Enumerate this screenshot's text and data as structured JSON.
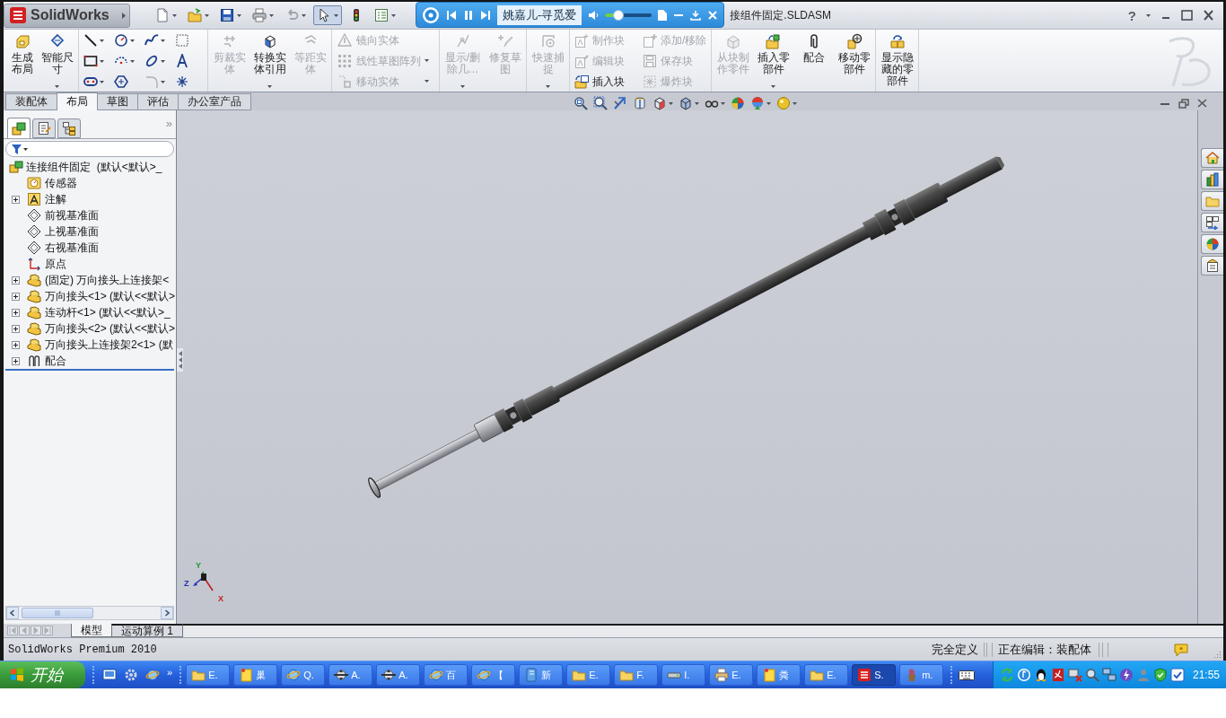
{
  "title_bar": {
    "logo": "SolidWorks",
    "document_title": "接组件固定.SLDASM",
    "help": "?"
  },
  "quick_access": [
    {
      "kind": "new",
      "dropdown": true,
      "pressed": false
    },
    {
      "kind": "open",
      "dropdown": true,
      "pressed": false
    },
    {
      "kind": "save",
      "dropdown": true,
      "pressed": false
    },
    {
      "kind": "print",
      "dropdown": true,
      "pressed": false
    },
    {
      "kind": "undo",
      "dropdown": true,
      "pressed": false
    },
    {
      "kind": "select",
      "dropdown": true,
      "pressed": true
    },
    {
      "kind": "rebuild",
      "dropdown": false,
      "pressed": false
    },
    {
      "kind": "options",
      "dropdown": true,
      "pressed": false
    }
  ],
  "media_player": {
    "track": "姚嘉儿-寻觅爱",
    "playing": true,
    "volume": {
      "level": 0.28
    }
  },
  "ribbon": {
    "sections": [
      {
        "kind": "large",
        "items": [
          {
            "kind": "layout",
            "label": "生成布局",
            "disabled": false,
            "dropdown": false
          },
          {
            "kind": "dimension",
            "label": "智能尺寸",
            "disabled": false,
            "dropdown": true
          }
        ]
      },
      {
        "kind": "grid",
        "items": [
          {
            "kind": "line",
            "disabled": false,
            "dropdown": true
          },
          {
            "kind": "circle",
            "disabled": false,
            "dropdown": true
          },
          {
            "kind": "spline",
            "disabled": false,
            "dropdown": true
          },
          {
            "kind": "grid",
            "disabled": false,
            "dropdown": false
          },
          {
            "kind": "rectangle",
            "disabled": false,
            "dropdown": true
          },
          {
            "kind": "arc",
            "disabled": false,
            "dropdown": true
          },
          {
            "kind": "ellipse",
            "disabled": false,
            "dropdown": true
          },
          {
            "kind": "text",
            "disabled": false,
            "dropdown": false
          },
          {
            "kind": "slot",
            "disabled": false,
            "dropdown": true
          },
          {
            "kind": "polygon",
            "disabled": false,
            "dropdown": false
          },
          {
            "kind": "fillet",
            "disabled": true,
            "dropdown": true
          },
          {
            "kind": "point",
            "disabled": false,
            "dropdown": false
          }
        ]
      },
      {
        "kind": "large",
        "items": [
          {
            "kind": "trim",
            "label": "剪裁实体",
            "disabled": true,
            "dropdown": false
          },
          {
            "kind": "convert",
            "label": "转换实体引用",
            "disabled": false,
            "dropdown": true
          },
          {
            "kind": "offset",
            "label": "等距实体",
            "disabled": true,
            "dropdown": false
          }
        ]
      },
      {
        "kind": "stack",
        "items": [
          {
            "kind": "mirror",
            "label": "镜向实体",
            "disabled": true,
            "dropdown": false
          },
          {
            "kind": "pattern",
            "label": "线性草图阵列",
            "disabled": true,
            "dropdown": true
          },
          {
            "kind": "move",
            "label": "移动实体",
            "disabled": true,
            "dropdown": true
          }
        ]
      },
      {
        "kind": "large",
        "items": [
          {
            "kind": "relations",
            "label": "显示/删除几…",
            "disabled": true,
            "dropdown": true
          },
          {
            "kind": "repair",
            "label": "修复草图",
            "disabled": true,
            "dropdown": false
          }
        ]
      },
      {
        "kind": "large",
        "items": [
          {
            "kind": "snap",
            "label": "快速捕捉",
            "disabled": true,
            "dropdown": true
          }
        ]
      },
      {
        "kind": "stack",
        "items": [
          {
            "kind": "makeblock",
            "label": "制作块",
            "disabled": true,
            "dropdown": false
          },
          {
            "kind": "editblock",
            "label": "编辑块",
            "disabled": true,
            "dropdown": false
          },
          {
            "kind": "insertblock",
            "label": "插入块",
            "disabled": false,
            "dropdown": false
          },
          {
            "kind": "addremove",
            "label": "添加/移除",
            "disabled": true,
            "dropdown": false
          },
          {
            "kind": "saveblock",
            "label": "保存块",
            "disabled": true,
            "dropdown": false
          },
          {
            "kind": "explodeblock",
            "label": "爆炸块",
            "disabled": true,
            "dropdown": false
          }
        ]
      },
      {
        "kind": "large",
        "items": [
          {
            "kind": "partfromblock",
            "label": "从块制作零件",
            "disabled": true,
            "dropdown": false
          },
          {
            "kind": "insertcomponent",
            "label": "插入零部件",
            "disabled": false,
            "dropdown": true
          },
          {
            "kind": "mate",
            "label": "配合",
            "disabled": false,
            "dropdown": false
          },
          {
            "kind": "movecomponent",
            "label": "移动零部件",
            "disabled": false,
            "dropdown": false
          }
        ]
      },
      {
        "kind": "large",
        "items": [
          {
            "kind": "showhidden",
            "label": "显示隐藏的零部件",
            "disabled": false,
            "dropdown": false
          }
        ]
      }
    ]
  },
  "tabs": [
    {
      "label": "装配体",
      "selected": false
    },
    {
      "label": "布局",
      "selected": true
    },
    {
      "label": "草图",
      "selected": false
    },
    {
      "label": "评估",
      "selected": false
    },
    {
      "label": "办公室产品",
      "selected": false
    }
  ],
  "feature_manager": {
    "tabs": [
      {
        "kind": "tree",
        "selected": true
      },
      {
        "kind": "property",
        "selected": false
      },
      {
        "kind": "configuration",
        "selected": false
      }
    ],
    "more": "»",
    "tree": [
      {
        "label": "连接组件固定  (默认<默认>_",
        "kind": "assembly",
        "children": [
          {
            "label": "传感器",
            "kind": "sensors"
          },
          {
            "label": "注解",
            "kind": "annotations",
            "expanded": false
          },
          {
            "label": "前视基准面",
            "kind": "plane"
          },
          {
            "label": "上视基准面",
            "kind": "plane"
          },
          {
            "label": "右视基准面",
            "kind": "plane"
          },
          {
            "label": "原点",
            "kind": "origin"
          },
          {
            "label": "(固定) 万向接头上连接架<",
            "kind": "part",
            "expanded": false
          },
          {
            "label": "万向接头<1> (默认<<默认>",
            "kind": "part",
            "expanded": false
          },
          {
            "label": "连动杆<1> (默认<<默认>_",
            "kind": "part",
            "expanded": false
          },
          {
            "label": "万向接头<2> (默认<<默认>",
            "kind": "part",
            "expanded": false
          },
          {
            "label": "万向接头上连接架2<1> (默",
            "kind": "part",
            "expanded": false
          },
          {
            "label": "配合",
            "kind": "mates",
            "expanded": false
          }
        ]
      }
    ]
  },
  "bottom_tabs": [
    {
      "label": "模型",
      "selected": true
    },
    {
      "label": "运动算例 1",
      "selected": false
    }
  ],
  "triad": {
    "x": "X",
    "y": "Y",
    "z": "Z"
  },
  "status_bar": {
    "product": "SolidWorks Premium 2010",
    "state": "完全定义",
    "mode": "正在编辑：装配体"
  },
  "taskbar": {
    "start": "开始",
    "quick_launch_more": "»",
    "buttons": [
      {
        "label": "E.",
        "kind": "folder",
        "selected": false
      },
      {
        "label": "巢",
        "kind": "note",
        "selected": false
      },
      {
        "label": "Q.",
        "kind": "globe",
        "selected": false
      },
      {
        "label": "A.",
        "kind": "crosshair",
        "selected": false
      },
      {
        "label": "A.",
        "kind": "crosshair",
        "selected": false
      },
      {
        "label": "百",
        "kind": "globe",
        "selected": false
      },
      {
        "label": "【",
        "kind": "globe",
        "selected": false
      },
      {
        "label": "新",
        "kind": "notebook",
        "selected": false
      },
      {
        "label": "E.",
        "kind": "folder",
        "selected": false
      },
      {
        "label": "F.",
        "kind": "folder",
        "selected": false
      },
      {
        "label": "I.",
        "kind": "drive",
        "selected": false
      },
      {
        "label": "E.",
        "kind": "printer",
        "selected": false
      },
      {
        "label": "粪",
        "kind": "note",
        "selected": false
      },
      {
        "label": "E.",
        "kind": "folder",
        "selected": false
      },
      {
        "label": "S.",
        "kind": "app",
        "selected": true
      },
      {
        "label": "m.",
        "kind": "pencils",
        "selected": false
      }
    ],
    "clock": "21:55"
  }
}
